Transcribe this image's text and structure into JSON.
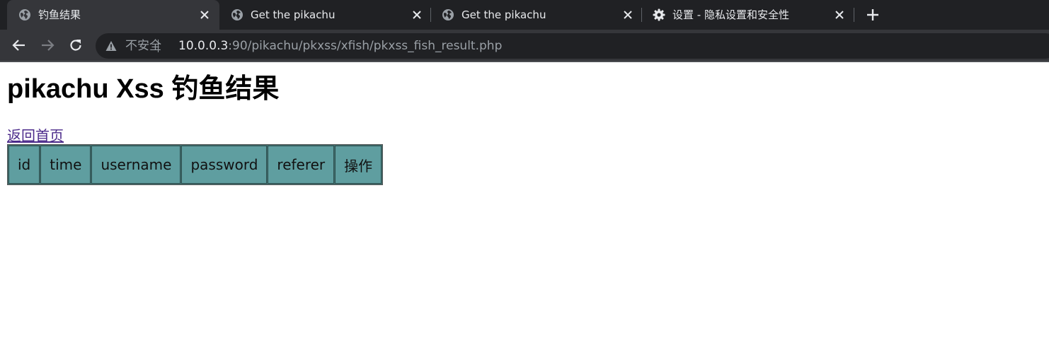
{
  "browser": {
    "tabs": [
      {
        "title": "钓鱼结果",
        "icon": "globe-icon",
        "active": true
      },
      {
        "title": "Get the pikachu",
        "icon": "globe-icon",
        "active": false
      },
      {
        "title": "Get the pikachu",
        "icon": "globe-icon",
        "active": false
      },
      {
        "title": "设置 - 隐私设置和安全性",
        "icon": "gear-icon",
        "active": false
      }
    ],
    "address": {
      "security_label": "不安全",
      "url_host": "10.0.0.3",
      "url_rest": ":90/pikachu/pkxss/xfish/pkxss_fish_result.php"
    }
  },
  "page": {
    "title": "pikachu Xss 钓鱼结果",
    "home_link": "返回首页",
    "table": {
      "headers": [
        "id",
        "time",
        "username",
        "password",
        "referer",
        "操作"
      ],
      "rows": []
    }
  },
  "colors": {
    "tabstrip_bg": "#202124",
    "toolbar_bg": "#35363a",
    "table_header_bg": "#5f9ea0",
    "link": "#4b2a8a"
  }
}
